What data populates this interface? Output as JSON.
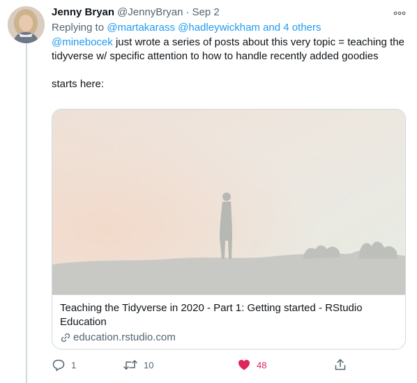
{
  "tweet": {
    "author_name": "Jenny Bryan",
    "author_handle": "@JennyBryan",
    "separator": "·",
    "date": "Sep 2",
    "reply_prefix": "Replying to",
    "reply_mentions": [
      "@martakarass",
      "@hadleywickham"
    ],
    "reply_and": "and",
    "reply_others": "4 others",
    "body_mention": "@minebocek",
    "body_text": " just wrote a series of posts about this very topic = teaching the tidyverse w/ specific attention to how to handle recently added goodies",
    "body_second": "starts here:"
  },
  "card": {
    "title": "Teaching the Tidyverse in 2020 - Part 1: Getting started - RStudio Education",
    "domain": "education.rstudio.com"
  },
  "actions": {
    "reply_count": "1",
    "retweet_count": "10",
    "like_count": "48"
  },
  "icons": {
    "more": "more-dots-icon",
    "reply": "reply-icon",
    "retweet": "retweet-icon",
    "like": "heart-icon",
    "share": "share-icon",
    "link": "link-icon"
  },
  "colors": {
    "link_blue": "#1d9bf0",
    "muted_gray": "#536471",
    "like_red": "#e0245e",
    "border": "#cfd9de"
  }
}
